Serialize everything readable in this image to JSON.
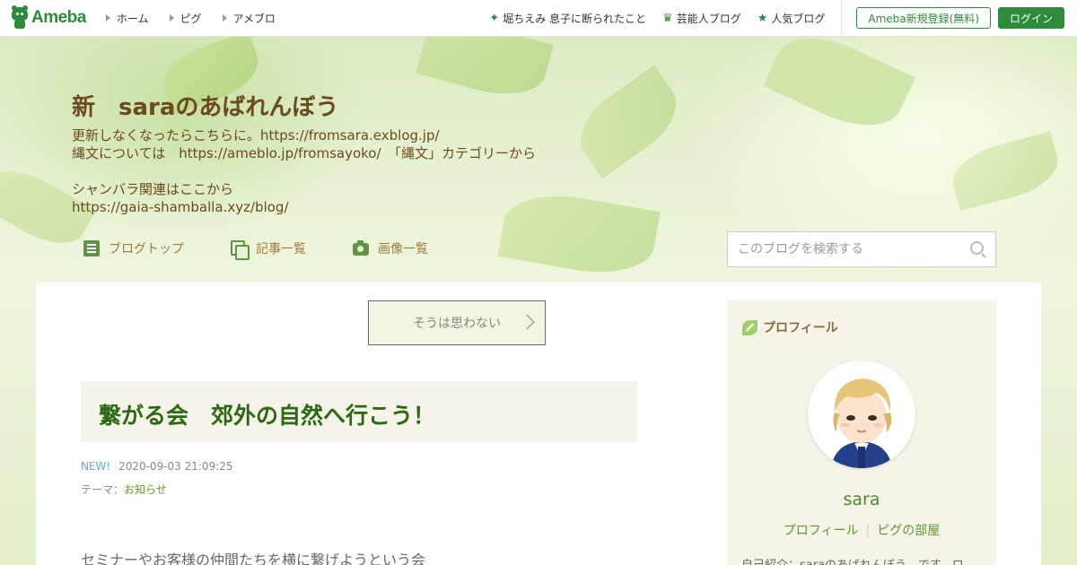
{
  "global_header": {
    "logo": "Ameba",
    "nav": [
      "ホーム",
      "ピグ",
      "アメブロ"
    ],
    "picks": [
      {
        "icon": "sparkle-icon",
        "label": "堀ちえみ 息子に断られたこと"
      },
      {
        "icon": "crown-icon",
        "label": "芸能人ブログ"
      },
      {
        "icon": "star-icon",
        "label": "人気ブログ"
      }
    ],
    "register_label": "Ameba新規登録(無料)",
    "login_label": "ログイン"
  },
  "blog": {
    "title": "新　saraのあばれんぼう",
    "description": [
      "更新しなくなったらこちらに。https://fromsara.exblog.jp/",
      "縄文については　https://ameblo.jp/fromsayoko/　「縄文」カテゴリーから",
      "",
      "シャンバラ関連はここから",
      "https://gaia-shamballa.xyz/blog/"
    ],
    "nav": [
      "ブログトップ",
      "記事一覧",
      "画像一覧"
    ],
    "search_placeholder": "このブログを検索する"
  },
  "entry": {
    "theme_button": "そうは思わない",
    "title": "繋がる会　郊外の自然へ行こう！",
    "new_badge": "NEW!",
    "datetime": "2020-09-03 21:09:25",
    "theme_label": "テーマ：",
    "theme_value": "お知らせ",
    "body_first_line": "セミナーやお客様の仲間たちを横に繋げようという会"
  },
  "profile": {
    "heading": "プロフィール",
    "name": "sara",
    "links": [
      "プロフィール",
      "ピグの部屋"
    ],
    "intro": "自己紹介：saraのあばれんぼう　です。ロ"
  },
  "colors": {
    "ameba_green": "#2d8c3c",
    "title_brown": "#6b4a1e",
    "entry_title_green": "#2b6a10"
  }
}
